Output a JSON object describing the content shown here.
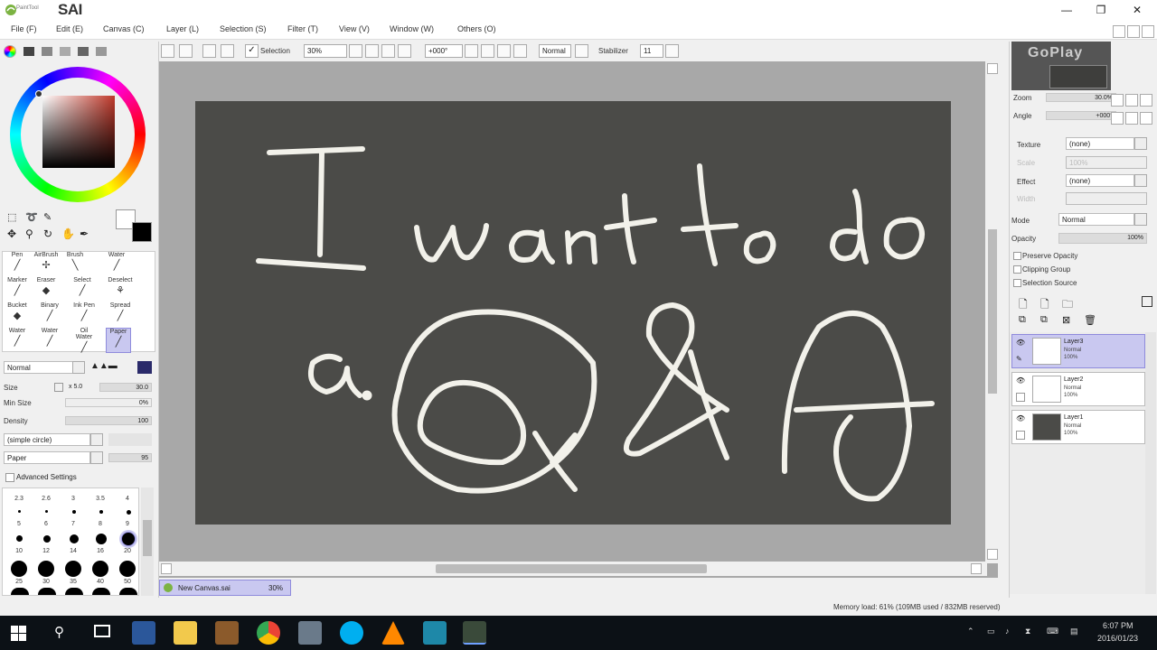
{
  "app": {
    "title": "SAI",
    "logo_text": "PaintTool"
  },
  "window_controls": {
    "minimize": "—",
    "maximize": "❐",
    "close": "✕"
  },
  "menu": [
    "File (F)",
    "Edit (E)",
    "Canvas (C)",
    "Layer (L)",
    "Selection (S)",
    "Filter (T)",
    "View (V)",
    "Window (W)",
    "Others (O)"
  ],
  "toolbar": {
    "selection_label": "Selection",
    "zoom_value": "30%",
    "angle_value": "+000°",
    "blend_value": "Normal",
    "stabilizer_label": "Stabilizer",
    "stabilizer_value": "11"
  },
  "tools": {
    "row1": [
      "Pen",
      "AirBrush",
      "Brush",
      "Water"
    ],
    "row2": [
      "Marker",
      "Eraser",
      "Select",
      "Deselect"
    ],
    "row3": [
      "Bucket",
      "Binary",
      "Ink Pen",
      "Spread"
    ],
    "row4": [
      "Water",
      "Water",
      "Oil Water",
      "Paper"
    ]
  },
  "brush_props": {
    "blend_mode": "Normal",
    "size_label": "Size",
    "size_mult": "x 5.0",
    "size_value": "30.0",
    "minsize_label": "Min Size",
    "minsize_value": "0%",
    "density_label": "Density",
    "density_value": "100",
    "shape": "(simple circle)",
    "texture": "Paper",
    "texture_value": "95",
    "advanced_label": "Advanced Settings"
  },
  "brush_sizes": {
    "row1": [
      "2.3",
      "2.6",
      "3",
      "3.5",
      "4"
    ],
    "row2": [
      "5",
      "6",
      "7",
      "8",
      "9"
    ],
    "row3": [
      "10",
      "12",
      "14",
      "16",
      "20"
    ],
    "row4": [
      "25",
      "30",
      "35",
      "40",
      "50"
    ]
  },
  "navigator": {
    "zoom_label": "Zoom",
    "zoom_value": "30.0%",
    "angle_label": "Angle",
    "angle_value": "+000°",
    "watermark": "GoPlay"
  },
  "layer_props": {
    "texture_label": "Texture",
    "texture_value": "(none)",
    "scale_label": "Scale",
    "scale_value": "100%",
    "effect_label": "Effect",
    "effect_value": "(none)",
    "width_label": "Width",
    "mode_label": "Mode",
    "mode_value": "Normal",
    "opacity_label": "Opacity",
    "opacity_value": "100%",
    "preserve_opacity": "Preserve Opacity",
    "clipping_group": "Clipping Group",
    "selection_source": "Selection Source"
  },
  "layers": [
    {
      "name": "Layer3",
      "mode": "Normal",
      "opacity": "100%"
    },
    {
      "name": "Layer2",
      "mode": "Normal",
      "opacity": "100%"
    },
    {
      "name": "Layer1",
      "mode": "Normal",
      "opacity": "100%"
    }
  ],
  "canvas": {
    "text_line1": "I want to do",
    "text_line2": "a. Q&A",
    "bg_color": "#4b4b48",
    "stroke_color": "#f2f1ea"
  },
  "document_tab": {
    "name": "New Canvas.sai",
    "zoom": "30%"
  },
  "status": {
    "memory": "Memory load: 61% (109MB used / 832MB reserved)"
  },
  "taskbar": {
    "time": "6:07 PM",
    "date": "2016/01/23"
  }
}
